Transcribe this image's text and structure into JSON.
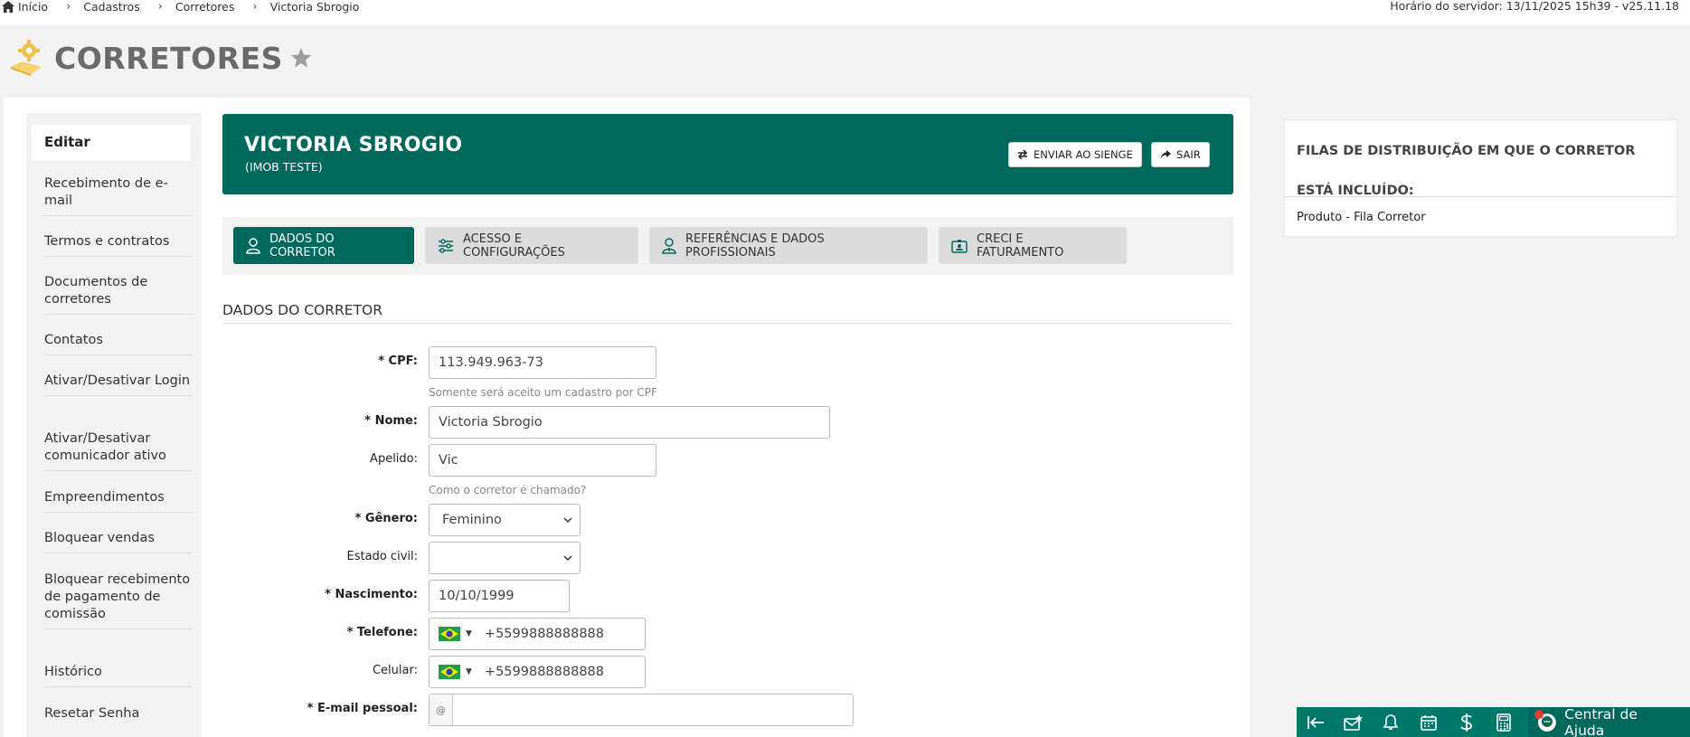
{
  "breadcrumb": {
    "items": [
      "Início",
      "Cadastros",
      "Corretores",
      "Victoria Sbrogio"
    ]
  },
  "server_time": "Horário do servidor: 13/11/2025 15h39 - v25.11.18",
  "page_title": "CORRETORES",
  "sidebar": {
    "active": "Editar",
    "items": [
      "Recebimento de e-mail",
      "Termos e contratos",
      "Documentos de corretores",
      "Contatos",
      "Ativar/Desativar Login",
      "Ativar/Desativar comunicador ativo",
      "Empreendimentos",
      "Bloquear vendas",
      "Bloquear recebimento de pagamento de comissão",
      "Histórico",
      "Resetar Senha"
    ]
  },
  "header": {
    "name": "VICTORIA SBROGIO",
    "company": "(IMOB TESTE)",
    "send_button": "ENVIAR AO SIENGE",
    "exit_button": "SAIR",
    "background_color": "#00695c"
  },
  "tabs": [
    {
      "label": "DADOS DO CORRETOR",
      "active": true,
      "icon": "user-icon"
    },
    {
      "label": "ACESSO E CONFIGURAÇÕES",
      "active": false,
      "icon": "sliders-icon"
    },
    {
      "label": "REFERÊNCIAS E DADOS PROFISSIONAIS",
      "active": false,
      "icon": "professional-icon"
    },
    {
      "label": "CRECI E FATURAMENTO",
      "active": false,
      "icon": "id-card-icon"
    }
  ],
  "form": {
    "section_title": "DADOS DO CORRETOR",
    "cpf": {
      "label": "* CPF:",
      "value": "113.949.963-73",
      "hint": "Somente será aceito um cadastro por CPF"
    },
    "nome": {
      "label": "* Nome:",
      "value": "Victoria Sbrogio"
    },
    "apelido": {
      "label": "Apelido:",
      "value": "Vic",
      "hint": "Como o corretor é chamado?"
    },
    "genero": {
      "label": "* Gênero:",
      "value": "Feminino"
    },
    "estado_civil": {
      "label": "Estado civil:",
      "value": ""
    },
    "nascimento": {
      "label": "* Nascimento:",
      "value": "10/10/1999"
    },
    "telefone": {
      "label": "* Telefone:",
      "value": "+5599888888888"
    },
    "celular": {
      "label": "Celular:",
      "value": "+5599888888888"
    },
    "email": {
      "label": "* E-mail pessoal:",
      "prefix": "@",
      "value": ""
    }
  },
  "distribution": {
    "title": "FILAS DE DISTRIBUIÇÃO EM QUE O CORRETOR ESTÁ INCLUÍDO:",
    "items": [
      "Produto - Fila Corretor"
    ]
  },
  "bottom_bar": {
    "icons": [
      "collapse-left-icon",
      "mail-star-icon",
      "bell-icon",
      "calendar-icon",
      "dollar-icon",
      "calculator-icon"
    ],
    "help_label": "Central de Ajuda"
  }
}
